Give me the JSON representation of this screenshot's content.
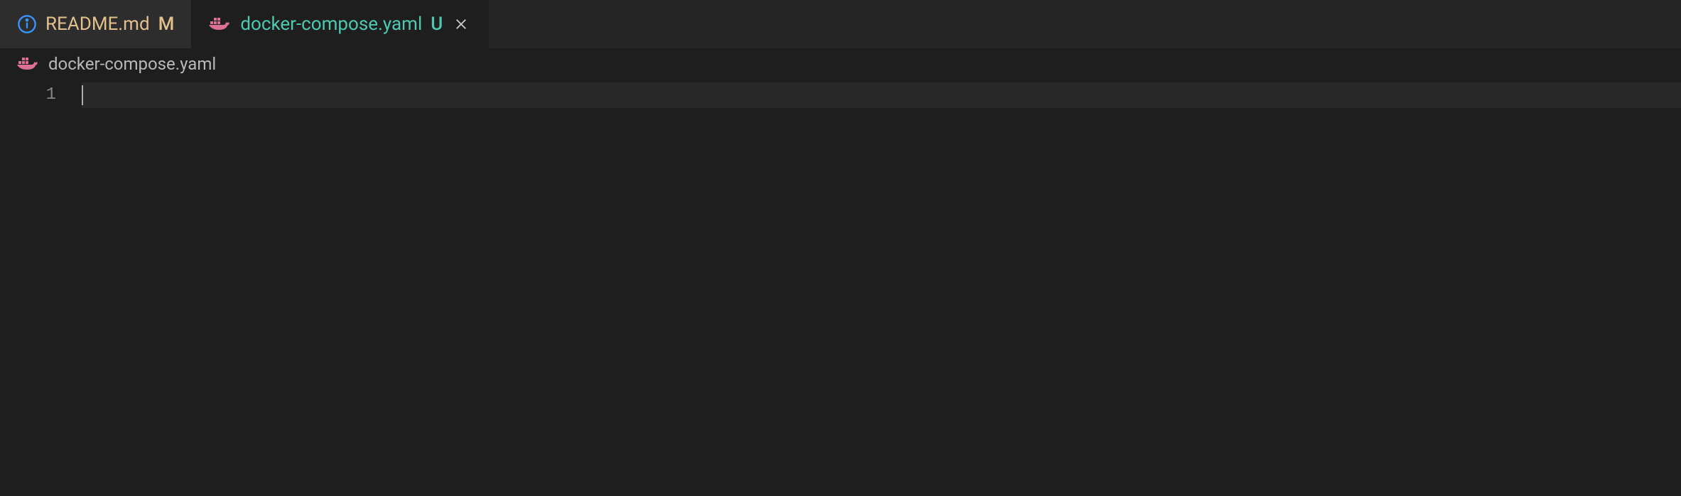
{
  "tabs": [
    {
      "label": "README.md",
      "status": "M",
      "icon": "info"
    },
    {
      "label": "docker-compose.yaml",
      "status": "U",
      "icon": "docker"
    }
  ],
  "breadcrumb": {
    "label": "docker-compose.yaml",
    "icon": "docker"
  },
  "editor": {
    "lineNumbers": [
      "1"
    ],
    "lines": [
      ""
    ]
  },
  "colors": {
    "modified": "#e2c08d",
    "untracked": "#4ec9b0",
    "infoIcon": "#3794ff",
    "dockerIcon": "#db7093"
  }
}
